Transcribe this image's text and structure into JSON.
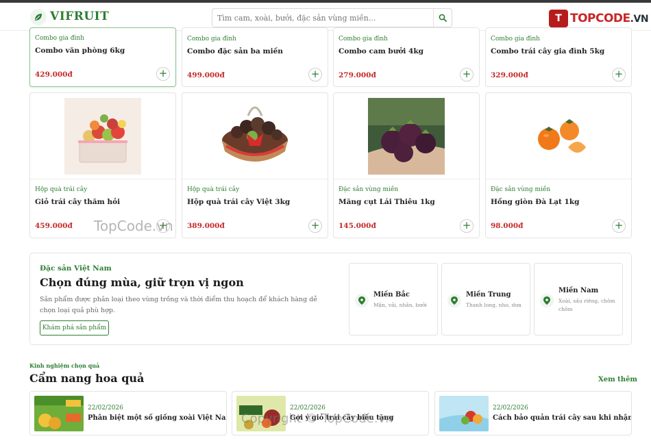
{
  "header": {
    "logo_text": "VIFRUIT",
    "search_placeholder": "Tìm cam, xoài, bưởi, đặc sản vùng miền...",
    "brand_mark": "T",
    "brand_text": "TOPCODE",
    "brand_tld": ".VN"
  },
  "products": [
    {
      "category": "Combo gia đình",
      "name": "Combo văn phòng 6kg",
      "price": "429.000đ"
    },
    {
      "category": "Combo gia đình",
      "name": "Combo đặc sản ba miền",
      "price": "499.000đ"
    },
    {
      "category": "Combo gia đình",
      "name": "Combo cam bưởi 4kg",
      "price": "279.000đ"
    },
    {
      "category": "Combo gia đình",
      "name": "Combo trái cây gia đình 5kg",
      "price": "329.000đ"
    },
    {
      "category": "Hộp quà trái cây",
      "name": "Giỏ trái cây thăm hỏi",
      "price": "459.000đ"
    },
    {
      "category": "Hộp quà trái cây",
      "name": "Hộp quà trái cây Việt 3kg",
      "price": "389.000đ"
    },
    {
      "category": "Đặc sản vùng miền",
      "name": "Măng cụt Lái Thiêu 1kg",
      "price": "145.000đ"
    },
    {
      "category": "Đặc sản vùng miền",
      "name": "Hồng giòn Đà Lạt 1kg",
      "price": "98.000đ"
    }
  ],
  "add_label": "+",
  "promo": {
    "kicker": "Đặc sản Việt Nam",
    "heading": "Chọn đúng mùa, giữ trọn vị ngon",
    "description": "Sản phẩm được phân loại theo vùng trồng và thời điểm thu hoạch để khách hàng dễ chọn loại quả phù hợp.",
    "cta": "Khám phá sản phẩm",
    "regions": [
      {
        "name": "Miền Bắc",
        "sub": "Mận, vải, nhãn, bưởi"
      },
      {
        "name": "Miền Trung",
        "sub": "Thanh long, nho, dưa"
      },
      {
        "name": "Miền Nam",
        "sub": "Xoài, sầu riêng, chôm chôm"
      }
    ]
  },
  "guide": {
    "kicker": "Kinh nghiệm chọn quả",
    "title": "Cẩm nang hoa quả",
    "more": "Xem thêm",
    "articles": [
      {
        "date": "22/02/2026",
        "title": "Phân biệt một số giống xoài Việt Nam"
      },
      {
        "date": "22/02/2026",
        "title": "Gợi ý giỏ trái cây biếu tặng"
      },
      {
        "date": "22/02/2026",
        "title": "Cách bảo quản trái cây sau khi nhận hàng"
      }
    ]
  },
  "watermarks": {
    "mid": "TopCode.vn",
    "bottom": "Copyright © TopCode.vn"
  },
  "colors": {
    "accent": "#2e7d32",
    "price": "#c62828",
    "brand": "#c62828"
  }
}
